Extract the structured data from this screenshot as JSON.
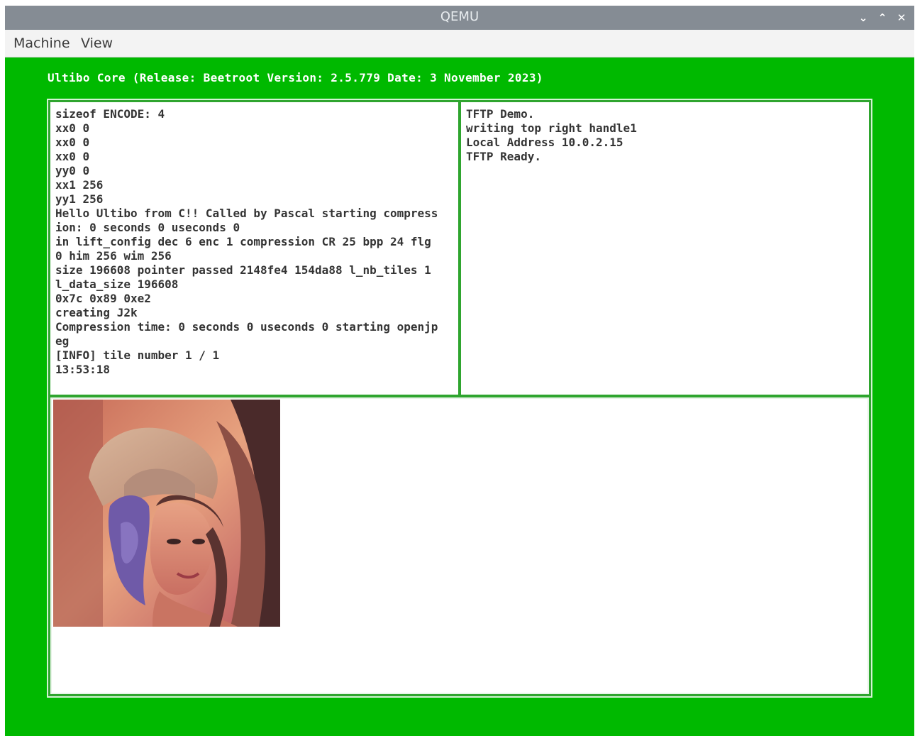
{
  "window": {
    "title": "QEMU",
    "controls": {
      "minimize": "⌄",
      "maximize": "⌃",
      "close": "✕"
    }
  },
  "menu": {
    "items": [
      "Machine",
      "View"
    ]
  },
  "screen": {
    "background": "#00b900",
    "header": "Ultibo Core (Release: Beetroot Version: 2.5.779 Date: 3 November 2023)",
    "left_console": {
      "lines": [
        "sizeof ENCODE: 4",
        "xx0 0",
        "xx0 0",
        "xx0 0",
        "yy0 0",
        "xx1 256",
        "yy1 256",
        "Hello Ultibo from C!! Called by Pascal starting compress",
        "ion: 0 seconds 0 useconds 0",
        "in lift_config dec 6 enc 1 compression CR 25 bpp 24 flg",
        "0 him 256 wim 256",
        "size 196608 pointer passed 2148fe4 154da88 l_nb_tiles 1",
        "l_data_size 196608",
        "0x7c 0x89 0xe2",
        "creating J2k",
        "Compression time: 0 seconds 0 useconds 0 starting openjp",
        "eg",
        "[INFO] tile number 1 / 1",
        "13:53:18"
      ]
    },
    "right_console": {
      "lines": [
        "TFTP Demo.",
        "writing top right handle1",
        "Local Address 10.0.2.15",
        "TFTP Ready."
      ]
    },
    "bottom_panel": {
      "image": "portrait-photo"
    }
  }
}
